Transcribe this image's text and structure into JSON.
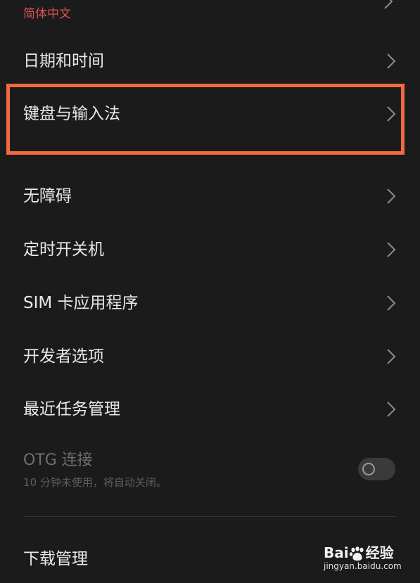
{
  "settings": {
    "language_value": "简体中文",
    "items": [
      {
        "label": "日期和时间"
      },
      {
        "label": "键盘与输入法"
      },
      {
        "label": "无障碍"
      },
      {
        "label": "定时开关机"
      },
      {
        "label": "SIM 卡应用程序"
      },
      {
        "label": "开发者选项"
      },
      {
        "label": "最近任务管理"
      }
    ],
    "otg": {
      "title": "OTG 连接",
      "description": "10 分钟未使用，将自动关闭。",
      "enabled": false
    },
    "download": {
      "label": "下载管理"
    }
  },
  "watermark": {
    "brand_left": "Bai",
    "brand_right": "经验",
    "url": "jingyan.baidu.com"
  },
  "colors": {
    "highlight": "#f26a3e",
    "subvalue": "#d9534f",
    "background": "#1b1b1b"
  }
}
